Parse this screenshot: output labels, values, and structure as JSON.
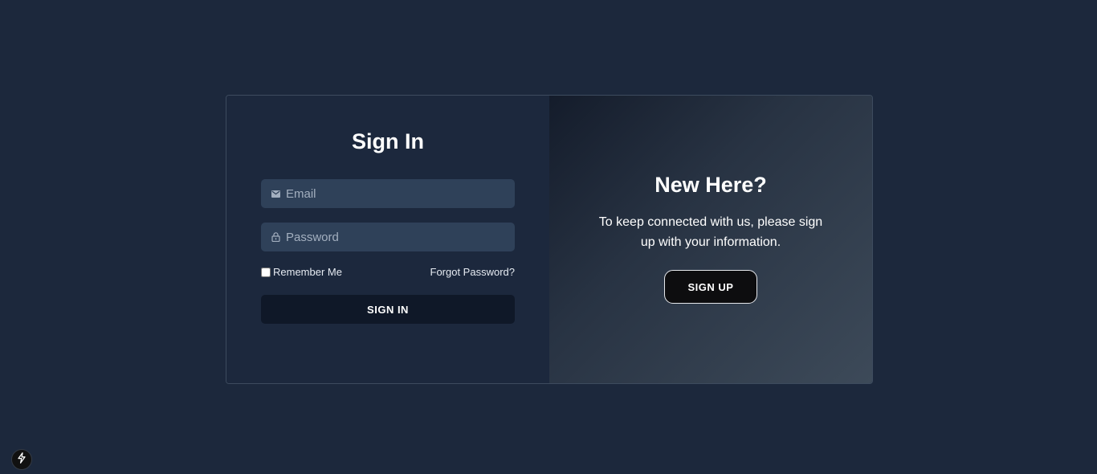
{
  "signin": {
    "title": "Sign In",
    "email_placeholder": "Email",
    "password_placeholder": "Password",
    "remember_label": "Remember Me",
    "forgot_label": "Forgot Password?",
    "button_label": "SIGN IN",
    "email_icon": "mail-icon",
    "password_icon": "lock-icon"
  },
  "signup_panel": {
    "title": "New Here?",
    "text": "To keep connected with us, please sign up with your information.",
    "button_label": "SIGN UP"
  },
  "dev_badge": {
    "icon": "lightning-icon"
  },
  "colors": {
    "background": "#1c283c",
    "field_bg": "#2f4159",
    "button_dark": "#0f1828"
  }
}
